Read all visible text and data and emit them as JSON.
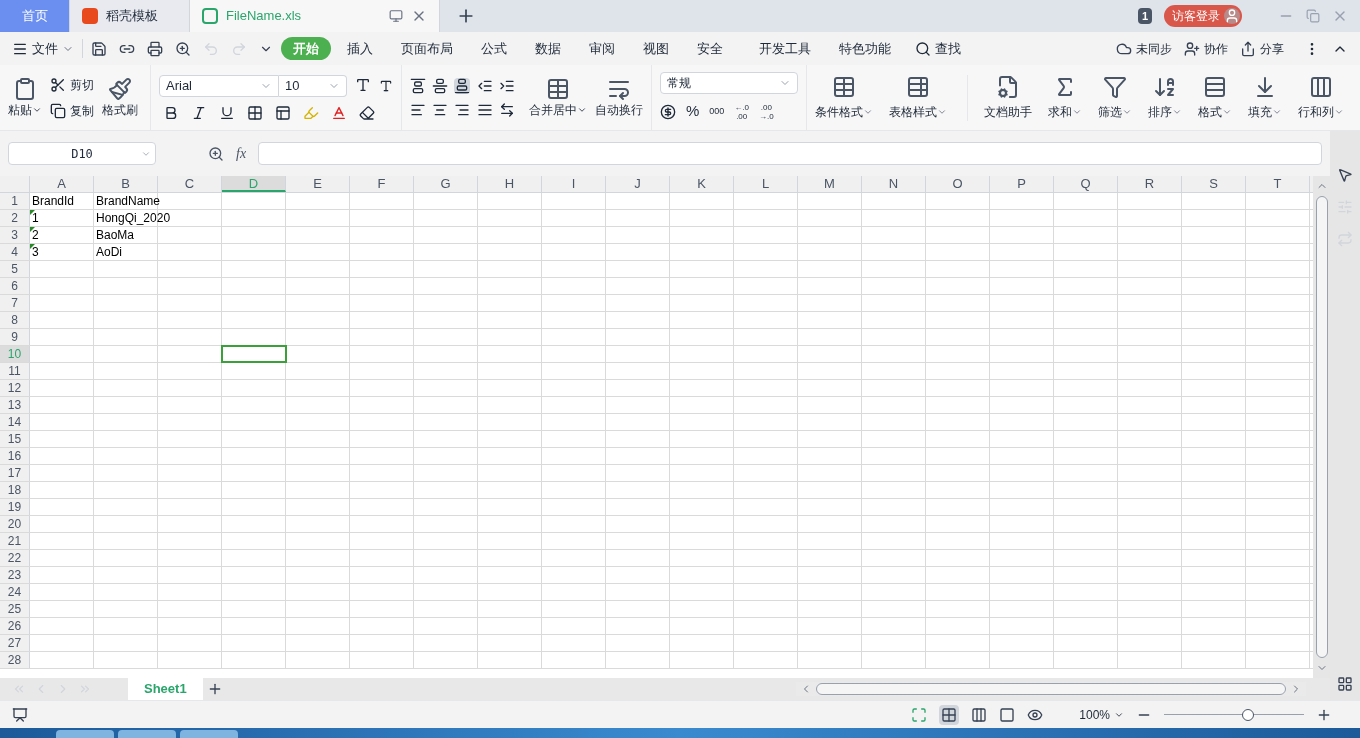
{
  "tabs": [
    {
      "label": "首页",
      "kind": "home",
      "selected": false
    },
    {
      "label": "稻壳模板",
      "kind": "docer",
      "selected": false
    },
    {
      "label": "FileName.xls",
      "kind": "sheet",
      "selected": true
    }
  ],
  "title_bar": {
    "badge": "1",
    "login": "访客登录"
  },
  "menu": {
    "file": "文件",
    "search": "查找",
    "tabs": [
      {
        "label": "开始",
        "selected": true
      },
      {
        "label": "插入",
        "selected": false
      },
      {
        "label": "页面布局",
        "selected": false
      },
      {
        "label": "公式",
        "selected": false
      },
      {
        "label": "数据",
        "selected": false
      },
      {
        "label": "审阅",
        "selected": false
      },
      {
        "label": "视图",
        "selected": false
      },
      {
        "label": "安全",
        "selected": false
      },
      {
        "label": "开发工具",
        "selected": false
      },
      {
        "label": "特色功能",
        "selected": false
      }
    ],
    "actions": [
      {
        "label": "未同步",
        "kind": "sync"
      },
      {
        "label": "协作",
        "kind": "collab"
      },
      {
        "label": "分享",
        "kind": "share"
      }
    ]
  },
  "ribbon": {
    "paste": "粘贴",
    "cut": "剪切",
    "copy": "复制",
    "painter": "格式刷",
    "font": "Arial",
    "size": "10",
    "merge": "合并居中",
    "wrap": "自动换行",
    "number_format": "常规",
    "percent": "%",
    "thousands": "000",
    "decimal_up": {
      "top": "←.0",
      "bottom": ".00"
    },
    "decimal_down": {
      "top": ".00",
      "bottom": "→.0"
    },
    "tools": [
      {
        "label": "条件格式",
        "kind": "cond",
        "caret": true
      },
      {
        "label": "表格样式",
        "kind": "style",
        "caret": true
      },
      {
        "label": "文档助手",
        "kind": "assist",
        "caret": false
      },
      {
        "label": "求和",
        "kind": "sum",
        "caret": true
      },
      {
        "label": "筛选",
        "kind": "filter",
        "caret": true
      },
      {
        "label": "排序",
        "kind": "sort",
        "caret": true
      },
      {
        "label": "格式",
        "kind": "format",
        "caret": true
      },
      {
        "label": "填充",
        "kind": "fill",
        "caret": true
      },
      {
        "label": "行和列",
        "kind": "rowcol",
        "caret": true
      }
    ]
  },
  "formula_bar": {
    "name_box": "D10",
    "fx": "fx"
  },
  "sheet": {
    "columns": [
      {
        "label": "A",
        "selected": false
      },
      {
        "label": "B",
        "selected": false
      },
      {
        "label": "C",
        "selected": false
      },
      {
        "label": "D",
        "selected": true
      },
      {
        "label": "E",
        "selected": false
      },
      {
        "label": "F",
        "selected": false
      },
      {
        "label": "G",
        "selected": false
      },
      {
        "label": "H",
        "selected": false
      },
      {
        "label": "I",
        "selected": false
      },
      {
        "label": "J",
        "selected": false
      },
      {
        "label": "K",
        "selected": false
      },
      {
        "label": "L",
        "selected": false
      },
      {
        "label": "M",
        "selected": false
      },
      {
        "label": "N",
        "selected": false
      },
      {
        "label": "O",
        "selected": false
      },
      {
        "label": "P",
        "selected": false
      },
      {
        "label": "Q",
        "selected": false
      },
      {
        "label": "R",
        "selected": false
      },
      {
        "label": "S",
        "selected": false
      },
      {
        "label": "T",
        "selected": false
      }
    ],
    "rows": [
      {
        "label": "1",
        "selected": false,
        "cells": [
          {
            "text": "BrandId",
            "flagged": false
          },
          {
            "text": "BrandName",
            "flagged": false
          }
        ]
      },
      {
        "label": "2",
        "selected": false,
        "cells": [
          {
            "text": "1",
            "flagged": true
          },
          {
            "text": "HongQi_2020",
            "flagged": false
          }
        ]
      },
      {
        "label": "3",
        "selected": false,
        "cells": [
          {
            "text": "2",
            "flagged": true
          },
          {
            "text": "BaoMa",
            "flagged": false
          }
        ]
      },
      {
        "label": "4",
        "selected": false,
        "cells": [
          {
            "text": "3",
            "flagged": true
          },
          {
            "text": "AoDi",
            "flagged": false
          }
        ]
      },
      {
        "label": "5",
        "selected": false,
        "cells": []
      },
      {
        "label": "6",
        "selected": false,
        "cells": []
      },
      {
        "label": "7",
        "selected": false,
        "cells": []
      },
      {
        "label": "8",
        "selected": false,
        "cells": []
      },
      {
        "label": "9",
        "selected": false,
        "cells": []
      },
      {
        "label": "10",
        "selected": true,
        "cells": []
      },
      {
        "label": "11",
        "selected": false,
        "cells": []
      },
      {
        "label": "12",
        "selected": false,
        "cells": []
      },
      {
        "label": "13",
        "selected": false,
        "cells": []
      },
      {
        "label": "14",
        "selected": false,
        "cells": []
      },
      {
        "label": "15",
        "selected": false,
        "cells": []
      },
      {
        "label": "16",
        "selected": false,
        "cells": []
      },
      {
        "label": "17",
        "selected": false,
        "cells": []
      },
      {
        "label": "18",
        "selected": false,
        "cells": []
      },
      {
        "label": "19",
        "selected": false,
        "cells": []
      },
      {
        "label": "20",
        "selected": false,
        "cells": []
      },
      {
        "label": "21",
        "selected": false,
        "cells": []
      },
      {
        "label": "22",
        "selected": false,
        "cells": []
      },
      {
        "label": "23",
        "selected": false,
        "cells": []
      },
      {
        "label": "24",
        "selected": false,
        "cells": []
      },
      {
        "label": "25",
        "selected": false,
        "cells": []
      },
      {
        "label": "26",
        "selected": false,
        "cells": []
      },
      {
        "label": "27",
        "selected": false,
        "cells": []
      },
      {
        "label": "28",
        "selected": false,
        "cells": []
      }
    ]
  },
  "sheet_tabs": [
    {
      "label": "Sheet1",
      "selected": true
    }
  ],
  "status_bar": {
    "zoom": "100%",
    "level": 0.6
  }
}
